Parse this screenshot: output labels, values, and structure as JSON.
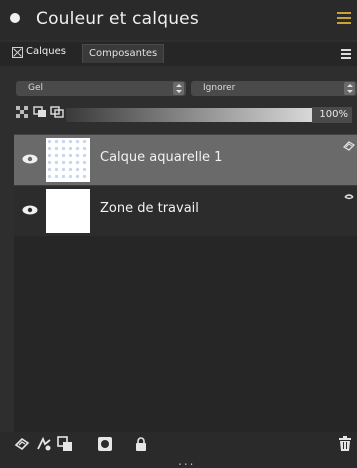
{
  "panel": {
    "title": "Couleur et calques",
    "accent_color": "#c9a23a"
  },
  "tabs": [
    {
      "label": "Calques",
      "active": true
    },
    {
      "label": "Composantes",
      "active": false
    }
  ],
  "blend_dropdown": {
    "value": "Gel"
  },
  "mode_dropdown": {
    "value": "Ignorer"
  },
  "opacity": {
    "value": "100%"
  },
  "layers": [
    {
      "name": "Calque aquarelle 1",
      "visible": true,
      "selected": true,
      "thumb": "watercolor-checker",
      "badge_icon": "watercolor-badge-icon"
    },
    {
      "name": "Zone de travail",
      "visible": true,
      "selected": false,
      "thumb": "white",
      "badge_icon": "link-badge-icon"
    }
  ],
  "toolbar": {
    "icons": [
      "new-layer-icon",
      "layer-effects-icon",
      "duplicate-layer-icon",
      "mask-icon",
      "lock-icon",
      "trash-icon"
    ],
    "more": "..."
  }
}
